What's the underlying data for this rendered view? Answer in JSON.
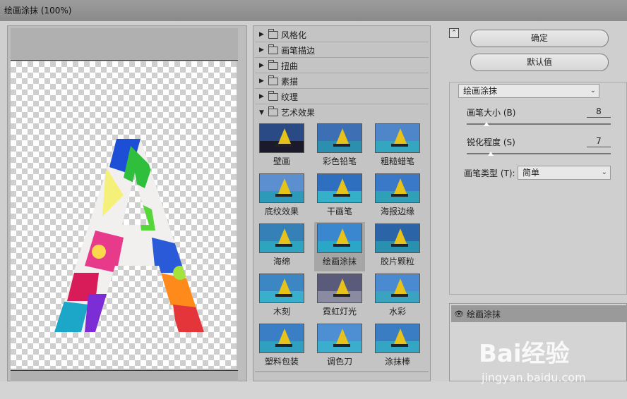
{
  "window": {
    "title": "绘画涂抹 (100%)"
  },
  "categories": [
    {
      "label": "风格化",
      "expanded": false
    },
    {
      "label": "画笔描边",
      "expanded": false
    },
    {
      "label": "扭曲",
      "expanded": false
    },
    {
      "label": "素描",
      "expanded": false
    },
    {
      "label": "纹理",
      "expanded": false
    },
    {
      "label": "艺术效果",
      "expanded": true
    }
  ],
  "filters": [
    {
      "label": "壁画"
    },
    {
      "label": "彩色铅笔"
    },
    {
      "label": "粗糙蜡笔"
    },
    {
      "label": "底纹效果"
    },
    {
      "label": "干画笔"
    },
    {
      "label": "海报边缘"
    },
    {
      "label": "海绵"
    },
    {
      "label": "绘画涂抹",
      "selected": true
    },
    {
      "label": "胶片颗粒"
    },
    {
      "label": "木刻"
    },
    {
      "label": "霓虹灯光"
    },
    {
      "label": "水彩"
    },
    {
      "label": "塑料包装"
    },
    {
      "label": "调色刀"
    },
    {
      "label": "涂抹棒"
    }
  ],
  "buttons": {
    "ok": "确定",
    "default": "默认值"
  },
  "settings": {
    "filter_select": "绘画涂抹",
    "brush_size": {
      "label": "画笔大小 (B)",
      "value": "8"
    },
    "sharpness": {
      "label": "锐化程度 (S)",
      "value": "7"
    },
    "brush_type": {
      "label": "画笔类型 (T):",
      "value": "简单"
    }
  },
  "layers": [
    {
      "label": "绘画涂抹"
    }
  ],
  "watermark": {
    "text": "Bai经验",
    "sub": "jingyan.baidu.com"
  }
}
